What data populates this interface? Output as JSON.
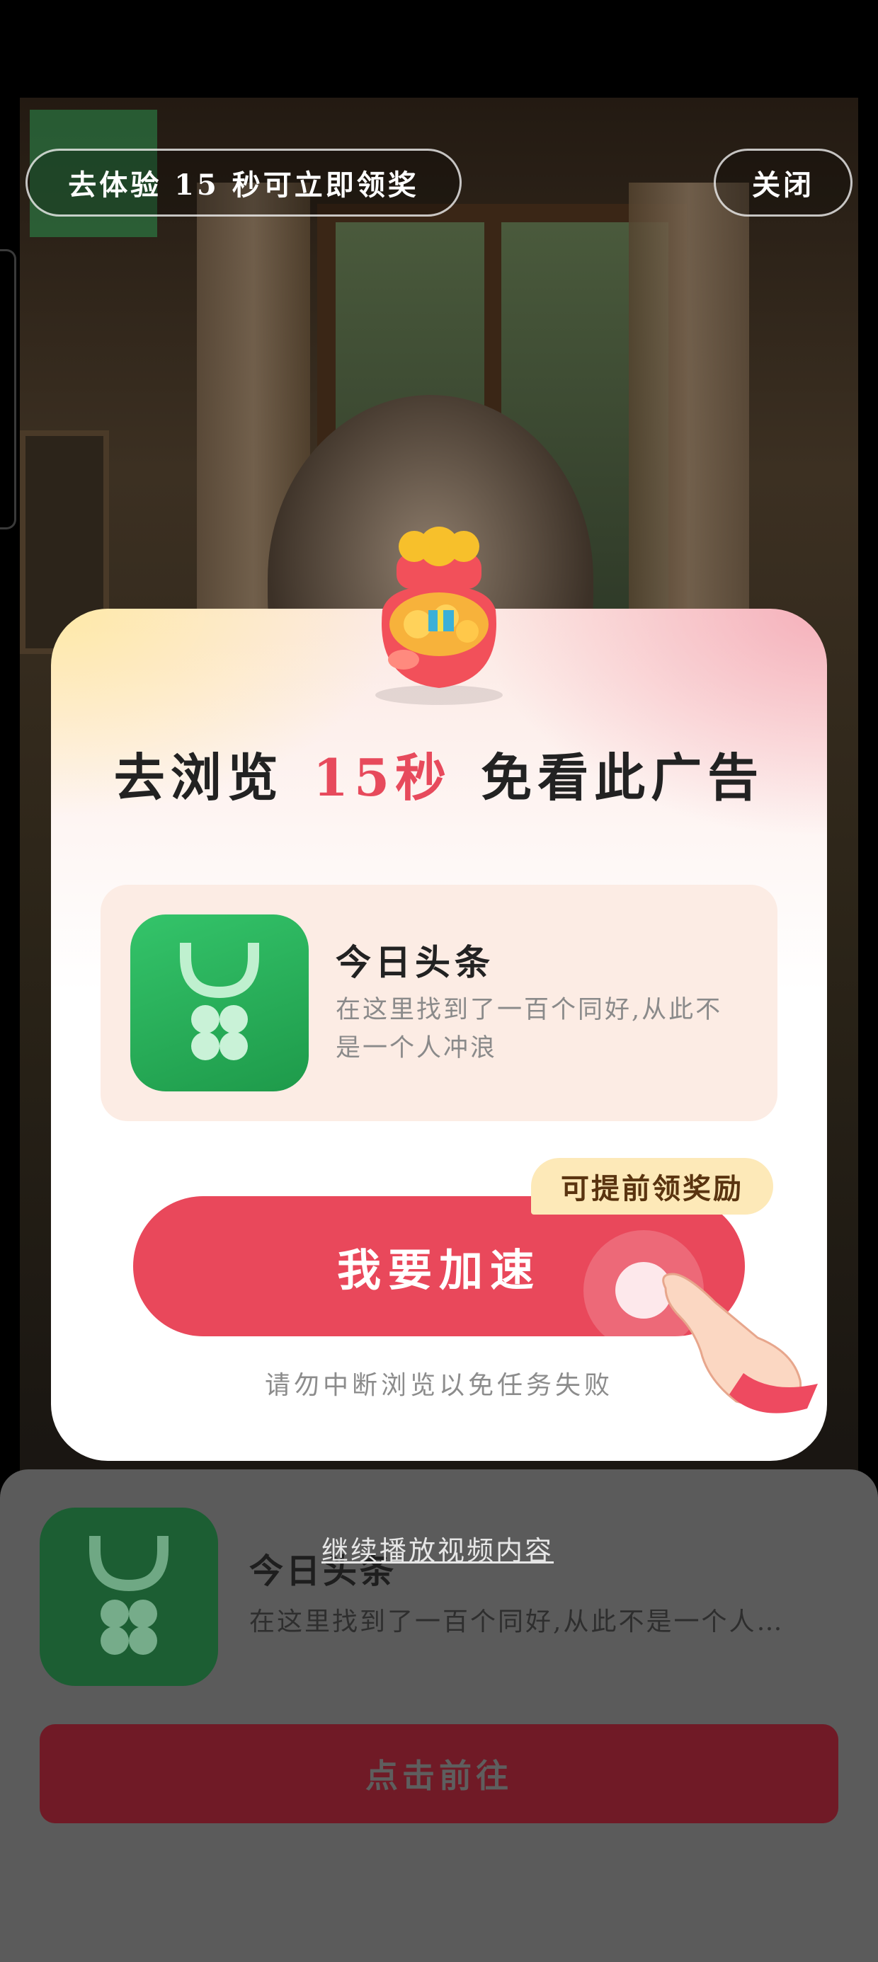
{
  "top_bar": {
    "experience_text": "去体验 15 秒可立即领奖",
    "close_label": "关闭"
  },
  "dialog": {
    "title_before": "去浏览",
    "title_highlight": "15秒",
    "title_after": "免看此广告",
    "app": {
      "name": "今日头条",
      "description": "在这里找到了一百个同好,从此不是一个人冲浪",
      "icon": "toutiao-app-icon"
    },
    "badge": "可提前领奖励",
    "speed_button": "我要加速",
    "warning": "请勿中断浏览以免任务失败"
  },
  "bottom_sheet": {
    "continue_link": "继续播放视频内容",
    "app_name": "今日头条",
    "app_description": "在这里找到了一百个同好,从此不是一个人…",
    "go_button": "点击前往"
  },
  "colors": {
    "accent_red": "#e9485b",
    "badge_yellow": "#fde9b8",
    "app_green": "#2fb85e"
  }
}
